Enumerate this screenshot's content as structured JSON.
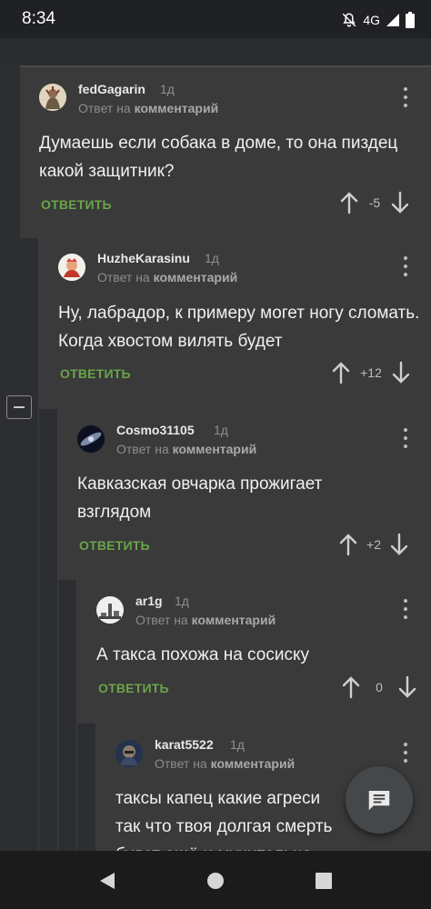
{
  "status_bar": {
    "time": "8:34",
    "network": "4G"
  },
  "comments": [
    {
      "username": "fedGagarin",
      "age": "1д",
      "reply_prefix": "Ответ на",
      "reply_target": "комментарий",
      "text": "Думаешь если собака в доме, то она пиздец какой защитник?",
      "reply_label": "ОТВЕТИТЬ",
      "score": "-5"
    },
    {
      "username": "HuzheKarasinu",
      "age": "1д",
      "reply_prefix": "Ответ на",
      "reply_target": "комментарий",
      "text": "Ну, лабрадор, к примеру могет ногу сломать. Когда хвостом вилять будет",
      "reply_label": "ОТВЕТИТЬ",
      "score": "+12"
    },
    {
      "username": "Cosmo31105",
      "age": "1д",
      "reply_prefix": "Ответ на",
      "reply_target": "комментарий",
      "text": "Кавказская овчарка прожигает взглядом",
      "reply_label": "ОТВЕТИТЬ",
      "score": "+2"
    },
    {
      "username": "ar1g",
      "age": "1д",
      "reply_prefix": "Ответ на",
      "reply_target": "комментарий",
      "text": "А такса похожа на сосиску",
      "reply_label": "ОТВЕТИТЬ",
      "score": "0"
    },
    {
      "username": "karat5522",
      "age": "1д",
      "reply_prefix": "Ответ на",
      "reply_target": "комментарий",
      "text": "таксы капец какие агреси так что твоя долгая смерть будет ещё и мучительна"
    }
  ],
  "icons": {
    "collapse": "minus-box-icon",
    "fab": "message-icon",
    "more": "more-vertical-icon",
    "upvote": "arrow-up-icon",
    "downvote": "arrow-down-icon",
    "nav": [
      "back-triangle-icon",
      "home-circle-icon",
      "recents-square-icon"
    ]
  },
  "colors": {
    "reply": "#68a54a",
    "card": "#3a3a3a",
    "background": "#1f2022"
  }
}
